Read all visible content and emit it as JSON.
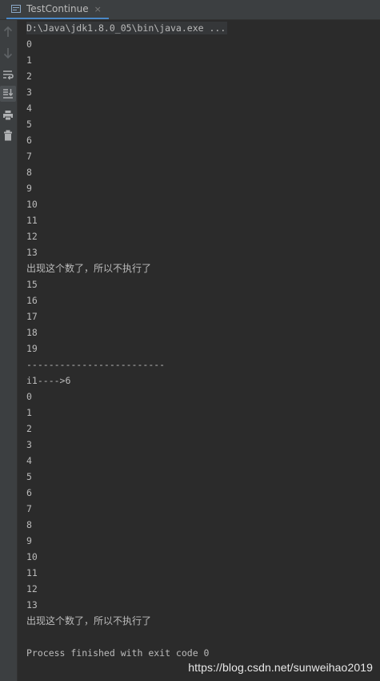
{
  "tab": {
    "title": "TestContinue",
    "close_glyph": "×"
  },
  "toolbar": {
    "icons": [
      "arrow-up-icon",
      "arrow-down-icon",
      "soft-wrap-icon",
      "scroll-to-end-icon",
      "print-icon",
      "trash-icon"
    ]
  },
  "console": {
    "command": "D:\\Java\\jdk1.8.0_05\\bin\\java.exe ...",
    "lines": [
      "0",
      "1",
      "2",
      "3",
      "4",
      "5",
      "6",
      "7",
      "8",
      "9",
      "10",
      "11",
      "12",
      "13",
      "出现这个数了，所以不执行了",
      "15",
      "16",
      "17",
      "18",
      "19",
      "-------------------------",
      "i1---->6",
      "0",
      "1",
      "2",
      "3",
      "4",
      "5",
      "6",
      "7",
      "8",
      "9",
      "10",
      "11",
      "12",
      "13",
      "出现这个数了，所以不执行了",
      "",
      "Process finished with exit code 0"
    ]
  },
  "watermark": "https://blog.csdn.net/sunweihao2019",
  "colors": {
    "background": "#2b2b2b",
    "panel": "#3c3f41",
    "text": "#bbbbbb",
    "accent": "#4a88c7"
  }
}
